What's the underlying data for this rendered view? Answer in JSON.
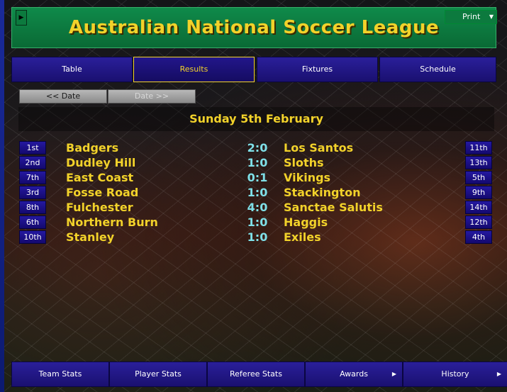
{
  "header": {
    "title": "Australian National Soccer League",
    "print_label": "Print"
  },
  "tabs": [
    {
      "label": "Table"
    },
    {
      "label": "Results",
      "active": true
    },
    {
      "label": "Fixtures"
    },
    {
      "label": "Schedule"
    }
  ],
  "date_nav": {
    "prev_label": "<< Date",
    "next_label": "Date >>"
  },
  "day_label": "Sunday 5th February",
  "results": [
    {
      "home_pos": "1st",
      "home": "Badgers",
      "score": "2:0",
      "away": "Los Santos",
      "away_pos": "11th"
    },
    {
      "home_pos": "2nd",
      "home": "Dudley Hill",
      "score": "1:0",
      "away": "Sloths",
      "away_pos": "13th"
    },
    {
      "home_pos": "7th",
      "home": "East Coast",
      "score": "0:1",
      "away": "Vikings",
      "away_pos": "5th"
    },
    {
      "home_pos": "3rd",
      "home": "Fosse Road",
      "score": "1:0",
      "away": "Stackington",
      "away_pos": "9th"
    },
    {
      "home_pos": "8th",
      "home": "Fulchester",
      "score": "4:0",
      "away": "Sanctae Salutis",
      "away_pos": "14th"
    },
    {
      "home_pos": "6th",
      "home": "Northern Burn",
      "score": "1:0",
      "away": "Haggis",
      "away_pos": "12th"
    },
    {
      "home_pos": "10th",
      "home": "Stanley",
      "score": "1:0",
      "away": "Exiles",
      "away_pos": "4th"
    }
  ],
  "bottom_nav": [
    {
      "label": "Team Stats"
    },
    {
      "label": "Player Stats"
    },
    {
      "label": "Referee Stats"
    },
    {
      "label": "Awards",
      "has_submenu": true
    },
    {
      "label": "History",
      "has_submenu": true
    }
  ],
  "colors": {
    "accent_yellow": "#f2d22a",
    "score_cyan": "#7fe0e8",
    "header_green": "#0f8a4a",
    "button_blue": "#2a1f9a"
  },
  "icons": {
    "header_button": "arrow-right-icon",
    "print_dropdown": "chevron-down-icon",
    "submenu": "chevron-right-icon"
  }
}
